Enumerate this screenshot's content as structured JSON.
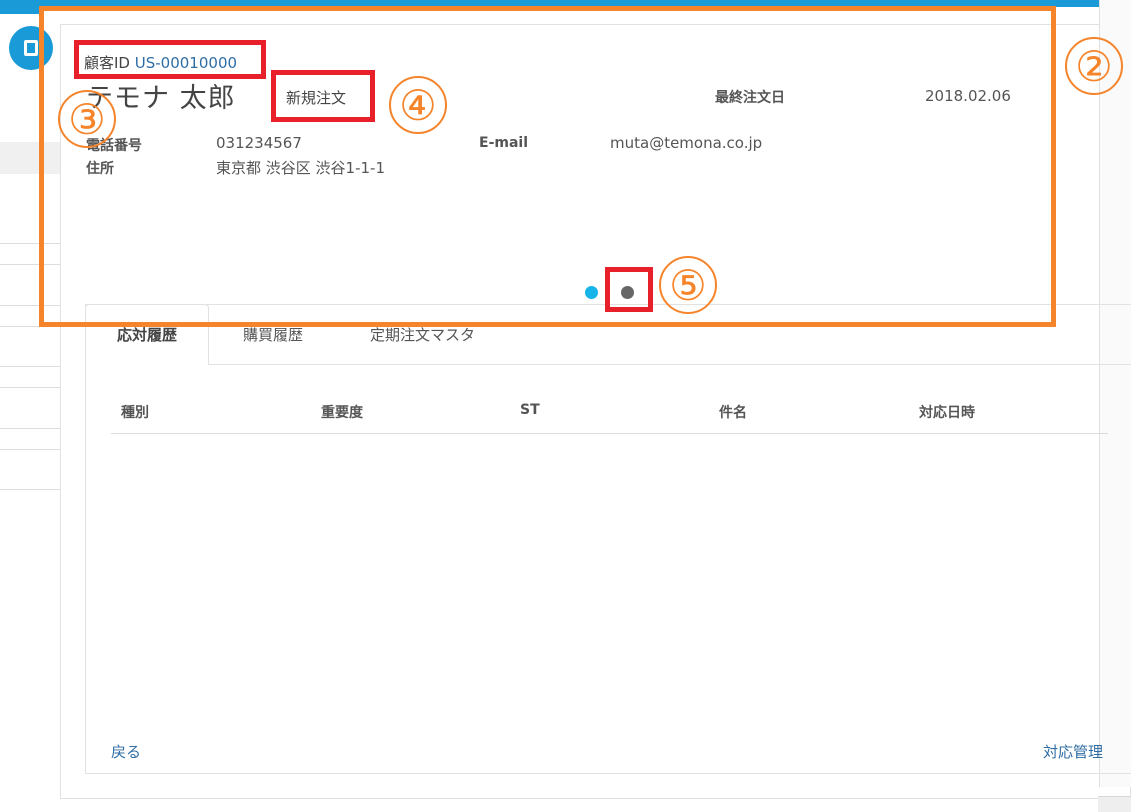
{
  "customer": {
    "id_label": "顧客ID",
    "id_value": "US-00010000",
    "name": "テモナ 太郎",
    "status_badge": "新規注文",
    "last_order_label": "最終注文日",
    "last_order_date": "2018.02.06",
    "phone_label": "電話番号",
    "phone": "031234567",
    "email_label": "E-mail",
    "email": "muta@temona.co.jp",
    "address_label": "住所",
    "address": "東京都 渋谷区 渋谷1-1-1"
  },
  "carousel": {
    "page_count": 2,
    "active_index": 0,
    "active_color": "#17b4ea",
    "inactive_color": "#666666"
  },
  "tabs": [
    {
      "label": "応対履歴",
      "active": true
    },
    {
      "label": "購買履歴",
      "active": false
    },
    {
      "label": "定期注文マスタ",
      "active": false
    }
  ],
  "table": {
    "headers": [
      "種別",
      "重要度",
      "ST",
      "件名",
      "対応日時"
    ]
  },
  "footer": {
    "back_link": "戻る",
    "manage_link": "対応管理"
  },
  "annotations": {
    "numbers": [
      "②",
      "③",
      "④",
      "⑤"
    ],
    "frame_color": "#f5842b",
    "highlight_color": "#e8202a"
  },
  "theme": {
    "accent": "#1a9ad6",
    "link": "#2e6da4"
  }
}
